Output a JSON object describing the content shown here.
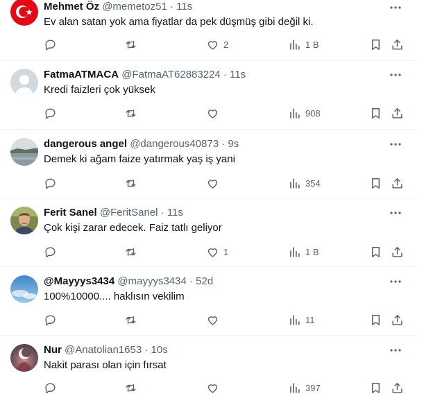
{
  "tweets": [
    {
      "name": "Mehmet Öz",
      "handle": "@memetoz51",
      "time": "11s",
      "text": "Ev alan satan yok ama fiyatlar da pek düşmüş gibi değil ki.",
      "likes": "2",
      "views": "1 B",
      "avatar": "turkish-flag"
    },
    {
      "name": "FatmaATMACA",
      "handle": "@FatmaAT62883224",
      "time": "11s",
      "text": "Kredi faizleri çok yüksek",
      "likes": "",
      "views": "908",
      "avatar": "default-person"
    },
    {
      "name": "dangerous angel",
      "handle": "@dangerous40873",
      "time": "9s",
      "text": "Demek ki ağam faize yatırmak yaş iş yani",
      "likes": "",
      "views": "354",
      "avatar": "landscape"
    },
    {
      "name": "Ferit Sanel",
      "handle": "@FeritSanel",
      "time": "11s",
      "text": "Çok kişi zarar edecek. Faiz tatlı geliyor",
      "likes": "1",
      "views": "1 B",
      "avatar": "man-photo"
    },
    {
      "name": "@Mayyys3434",
      "handle": "@mayyys3434",
      "time": "52d",
      "text": "100%10000.... haklısın vekilim",
      "likes": "",
      "views": "11",
      "avatar": "sky"
    },
    {
      "name": "Nur",
      "handle": "@Anatolian1653",
      "time": "10s",
      "text": "Nakit parası olan için fırsat",
      "likes": "",
      "views": "397",
      "avatar": "crescent"
    }
  ],
  "separator": "·"
}
